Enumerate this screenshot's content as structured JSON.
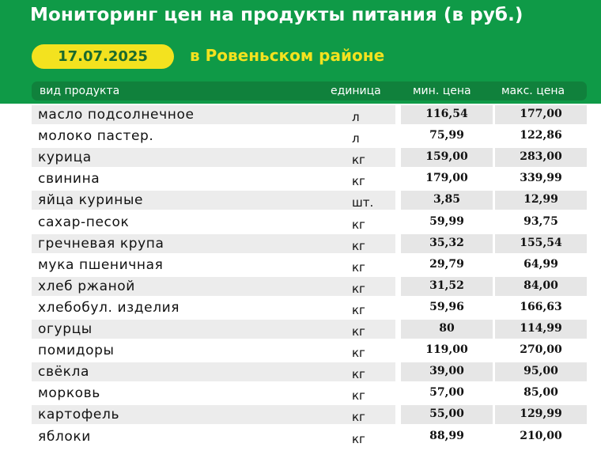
{
  "title": "Мониторинг цен на продукты питания (в руб.)",
  "date": "17.07.2025",
  "district": "в Ровеньском районе",
  "columns": {
    "product": "вид продукта",
    "unit": "единица",
    "min": "мин. цена",
    "max": "макс. цена"
  },
  "rows": [
    {
      "name": "масло подсолнечное",
      "unit": "л",
      "min": "116,54",
      "max": "177,00"
    },
    {
      "name": "молоко пастер.",
      "unit": "л",
      "min": "75,99",
      "max": "122,86"
    },
    {
      "name": "курица",
      "unit": "кг",
      "min": "159,00",
      "max": "283,00"
    },
    {
      "name": "свинина",
      "unit": "кг",
      "min": "179,00",
      "max": "339,99"
    },
    {
      "name": "яйца куриные",
      "unit": "шт.",
      "min": "3,85",
      "max": "12,99"
    },
    {
      "name": "сахар-песок",
      "unit": "кг",
      "min": "59,99",
      "max": "93,75"
    },
    {
      "name": "гречневая крупа",
      "unit": "кг",
      "min": "35,32",
      "max": "155,54"
    },
    {
      "name": "мука пшеничная",
      "unit": "кг",
      "min": "29,79",
      "max": "64,99"
    },
    {
      "name": "хлеб ржаной",
      "unit": "кг",
      "min": "31,52",
      "max": "84,00"
    },
    {
      "name": "хлебобул. изделия",
      "unit": "кг",
      "min": "59,96",
      "max": "166,63"
    },
    {
      "name": "огурцы",
      "unit": "кг",
      "min": "80",
      "max": "114,99"
    },
    {
      "name": "помидоры",
      "unit": "кг",
      "min": "119,00",
      "max": "270,00"
    },
    {
      "name": "свёкла",
      "unit": "кг",
      "min": "39,00",
      "max": "95,00"
    },
    {
      "name": "морковь",
      "unit": "кг",
      "min": "57,00",
      "max": "85,00"
    },
    {
      "name": "картофель",
      "unit": "кг",
      "min": "55,00",
      "max": "129,99"
    },
    {
      "name": "яблоки",
      "unit": "кг",
      "min": "88,99",
      "max": "210,00"
    }
  ],
  "colors": {
    "header_green": "#0f9a47",
    "column_header_green": "#10813c",
    "accent_yellow": "#f3e21f",
    "cell_gray": "#e6e6e6"
  }
}
